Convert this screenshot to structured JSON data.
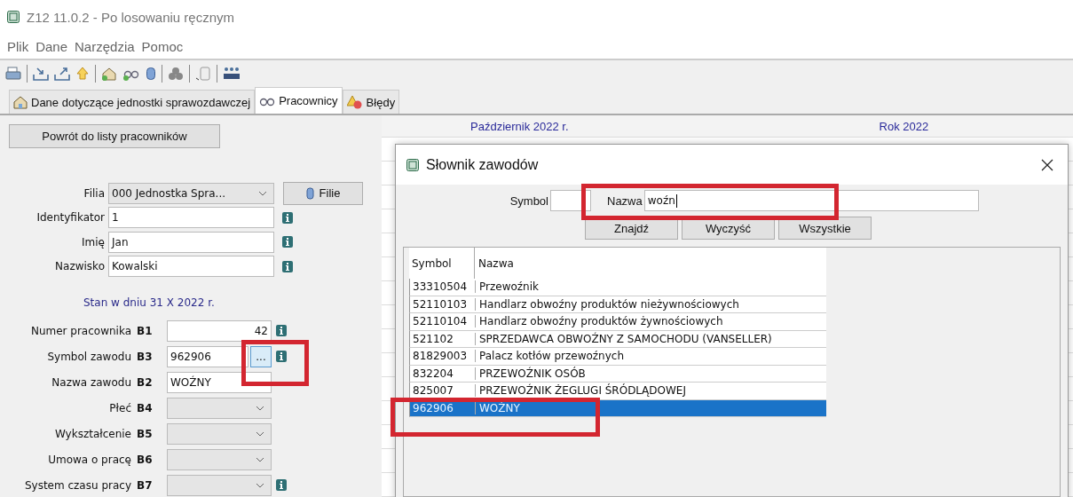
{
  "window": {
    "title": "Z12 11.0.2 - Po losowaniu ręcznym"
  },
  "menu": [
    "Plik",
    "Dane",
    "Narzędzia",
    "Pomoc"
  ],
  "tabs": [
    {
      "label": "Dane dotyczące jednostki sprawozdawczej",
      "kind": "home",
      "selected": false
    },
    {
      "label": "Pracownicy",
      "kind": "glasses",
      "selected": true
    },
    {
      "label": "Błędy",
      "kind": "warning",
      "selected": false
    }
  ],
  "back_button": "Powrót do listy pracowników",
  "branch": {
    "label": "Filia",
    "value": "000 Jednostka Spra...",
    "button": "Filie"
  },
  "fields": [
    {
      "label": "Identyfikator",
      "value": "1",
      "info": true
    },
    {
      "label": "Imię",
      "value": "Jan",
      "info": true
    },
    {
      "label": "Nazwisko",
      "value": "Kowalski",
      "info": true
    }
  ],
  "status_caption": "Stan w dniu 31 X 2022 r.",
  "coded_fields": [
    {
      "label": "Numer pracownika",
      "code": "B1",
      "kind": "number",
      "value": "42",
      "info": true
    },
    {
      "label": "Symbol zawodu",
      "code": "B3",
      "kind": "lookup",
      "value": "962906",
      "button": "...",
      "info": true
    },
    {
      "label": "Nazwa zawodu",
      "code": "B2",
      "kind": "text",
      "value": "WOŹNY",
      "info": false
    },
    {
      "label": "Płeć",
      "code": "B4",
      "kind": "select",
      "info": false
    },
    {
      "label": "Wykształcenie",
      "code": "B5",
      "kind": "select",
      "info": false
    },
    {
      "label": "Umowa o pracę",
      "code": "B6",
      "kind": "select",
      "info": false
    },
    {
      "label": "System czasu pracy",
      "code": "B7",
      "kind": "select",
      "info": true
    }
  ],
  "period_header": {
    "month": "Październik 2022 r.",
    "year": "Rok 2022"
  },
  "dialog": {
    "title": "Słownik zawodów",
    "symbol_label": "Symbol",
    "name_label": "Nazwa",
    "name_value": "woźn",
    "buttons": [
      "Znajdź",
      "Wyczyść",
      "Wszystkie"
    ],
    "table": {
      "columns": [
        "Symbol",
        "Nazwa"
      ],
      "rows": [
        {
          "symbol": "33310504",
          "name": "Przewoźnik",
          "selected": false
        },
        {
          "symbol": "52110103",
          "name": "Handlarz obwoźny produktów nieżywnościowych",
          "selected": false
        },
        {
          "symbol": "52110104",
          "name": "Handlarz obwoźny produktów żywnościowych",
          "selected": false
        },
        {
          "symbol": "521102",
          "name": "SPRZEDAWCA OBWOŹNY Z SAMOCHODU (VANSELLER)",
          "selected": false
        },
        {
          "symbol": "81829003",
          "name": "Palacz kotłów przewoźnych",
          "selected": false
        },
        {
          "symbol": "832204",
          "name": "PRZEWOŹNIK OSÓB",
          "selected": false
        },
        {
          "symbol": "825007",
          "name": "PRZEWOŹNIK ŻEGLUGI ŚRÓDLĄDOWEJ",
          "selected": false
        },
        {
          "symbol": "962906",
          "name": "WOŹNY",
          "selected": true
        }
      ]
    }
  }
}
